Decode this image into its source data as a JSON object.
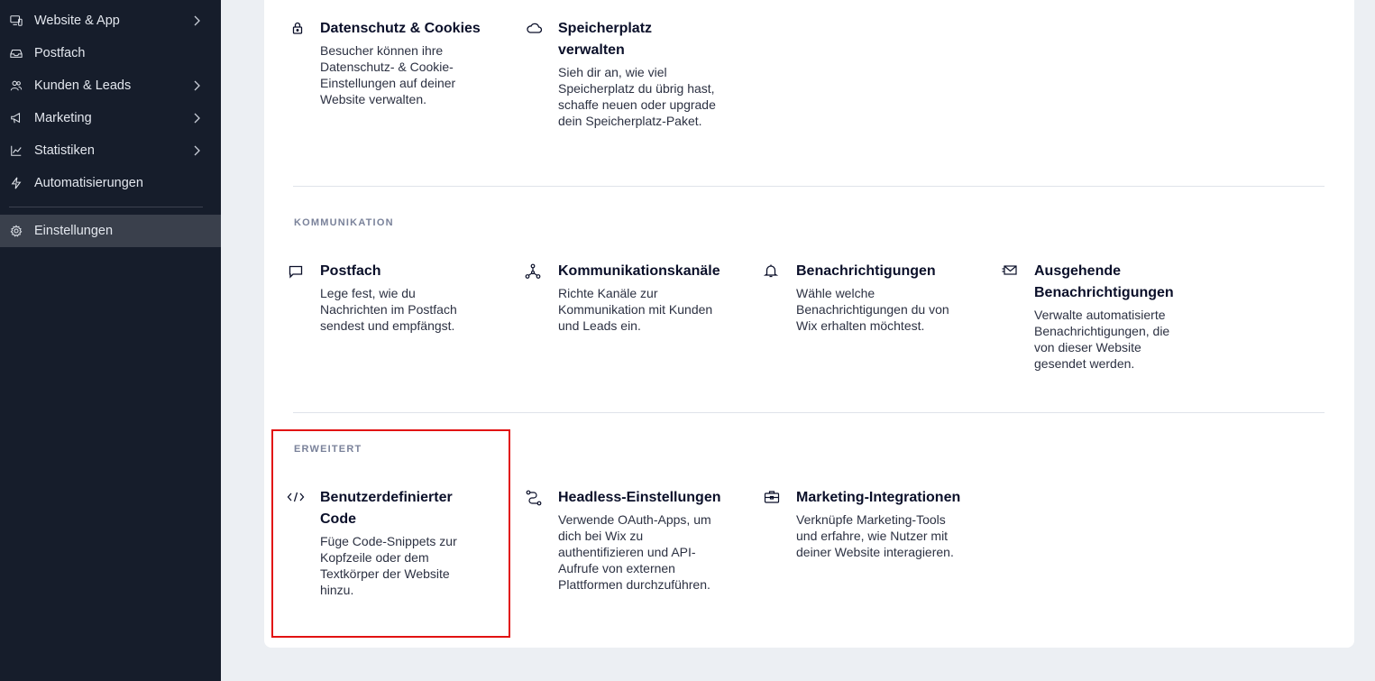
{
  "sidebar": {
    "items": [
      {
        "label": "Website & App",
        "icon": "monitor-icon",
        "has_chevron": true
      },
      {
        "label": "Postfach",
        "icon": "inbox-icon",
        "has_chevron": false
      },
      {
        "label": "Kunden & Leads",
        "icon": "people-icon",
        "has_chevron": true
      },
      {
        "label": "Marketing",
        "icon": "megaphone-icon",
        "has_chevron": true
      },
      {
        "label": "Statistiken",
        "icon": "chart-icon",
        "has_chevron": true
      },
      {
        "label": "Automatisierungen",
        "icon": "lightning-icon",
        "has_chevron": false
      },
      {
        "label": "Einstellungen",
        "icon": "gear-icon",
        "has_chevron": false,
        "active": true
      }
    ]
  },
  "main": {
    "top": {
      "items": [
        {
          "title": "Datenschutz & Cookies",
          "icon": "lock-icon",
          "desc": "Besucher können ihre Datenschutz- & Cookie-Einstellungen auf deiner Website verwalten."
        },
        {
          "title": "Speicherplatz verwalten",
          "icon": "cloud-icon",
          "desc": "Sieh dir an, wie viel Speicherplatz du übrig hast, schaffe neuen oder upgrade dein Speicherplatz-Paket."
        }
      ]
    },
    "kommunikation": {
      "title": "KOMMUNIKATION",
      "items": [
        {
          "title": "Postfach",
          "icon": "chat-icon",
          "desc": "Lege fest, wie du Nachrichten im Postfach sendest und empfängst."
        },
        {
          "title": "Kommunikationskanäle",
          "icon": "network-icon",
          "desc": "Richte Kanäle zur Kommunikation mit Kunden und Leads ein."
        },
        {
          "title": "Benachrichtigungen",
          "icon": "bell-icon",
          "desc": "Wähle welche Benachrichtigungen du von Wix erhalten möchtest."
        },
        {
          "title": "Ausgehende Benachrichtigungen",
          "icon": "envelope-icon",
          "desc": "Verwalte automatisierte Benachrichtigungen, die von dieser Website gesendet werden."
        }
      ]
    },
    "erweitert": {
      "title": "ERWEITERT",
      "items": [
        {
          "title": "Benutzerdefinierter Code",
          "icon": "code-icon",
          "desc": "Füge Code-Snippets zur Kopfzeile oder dem Textkörper der Website hinzu."
        },
        {
          "title": "Headless-Einstellungen",
          "icon": "route-icon",
          "desc": "Verwende OAuth-Apps, um dich bei Wix zu authentifizieren und API-Aufrufe von externen Plattformen durchzuführen."
        },
        {
          "title": "Marketing-Integrationen",
          "icon": "briefcase-icon",
          "desc": "Verknüpfe Marketing-Tools und erfahre, wie Nutzer mit deiner Website interagieren."
        }
      ]
    }
  },
  "colors": {
    "sidebar_bg": "#161d2b",
    "highlight": "#e21212",
    "page_bg": "#eceff3"
  }
}
